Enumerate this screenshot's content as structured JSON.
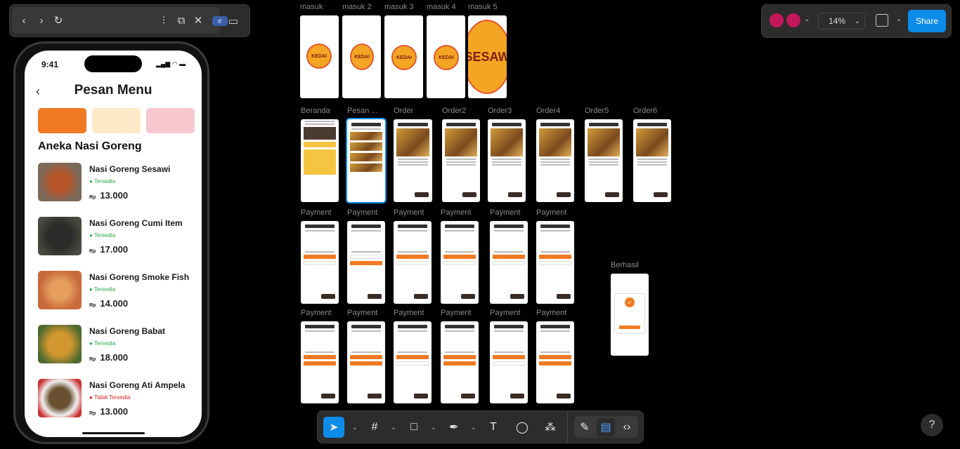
{
  "topbar": {
    "badge": "e"
  },
  "phone": {
    "time": "9:41",
    "title": "Pesan Menu",
    "section": "Aneka Nasi Goreng",
    "items": [
      {
        "name": "Nasi Goreng Sesawi",
        "status": "Tersedia",
        "currency": "Rp",
        "price": "13.000",
        "available": true
      },
      {
        "name": "Nasi Goreng Cumi Item",
        "status": "Tersedia",
        "currency": "Rp",
        "price": "17.000",
        "available": true
      },
      {
        "name": "Nasi Goreng Smoke Fish",
        "status": "Tersedia",
        "currency": "Rp",
        "price": "14.000",
        "available": true
      },
      {
        "name": "Nasi Goreng Babat",
        "status": "Tersedia",
        "currency": "Rp",
        "price": "18.000",
        "available": true
      },
      {
        "name": "Nasi Goreng Ati Ampela",
        "status": "Tidak Tersedia",
        "currency": "Rp",
        "price": "13.000",
        "available": false
      }
    ]
  },
  "canvas": {
    "row1": [
      "masuk",
      "masuk 2",
      "masuk 3",
      "masuk 4",
      "masuk 5"
    ],
    "row2": [
      "Beranda",
      "Pesan ...",
      "Order",
      "Order2",
      "Order3",
      "Order4",
      "Order5",
      "Order6"
    ],
    "row3": [
      "Payment",
      "Payment",
      "Payment",
      "Payment",
      "Payment",
      "Payment"
    ],
    "row4": [
      "Payment",
      "Payment",
      "Payment",
      "Payment",
      "Payment",
      "Payment"
    ],
    "success": "Berhasil",
    "logo_text": "KEDAI SESAWI"
  },
  "right": {
    "zoom": "14%",
    "share": "Share"
  },
  "colors": {
    "accent": "#0c8ce9",
    "brand": "#f07a22"
  }
}
